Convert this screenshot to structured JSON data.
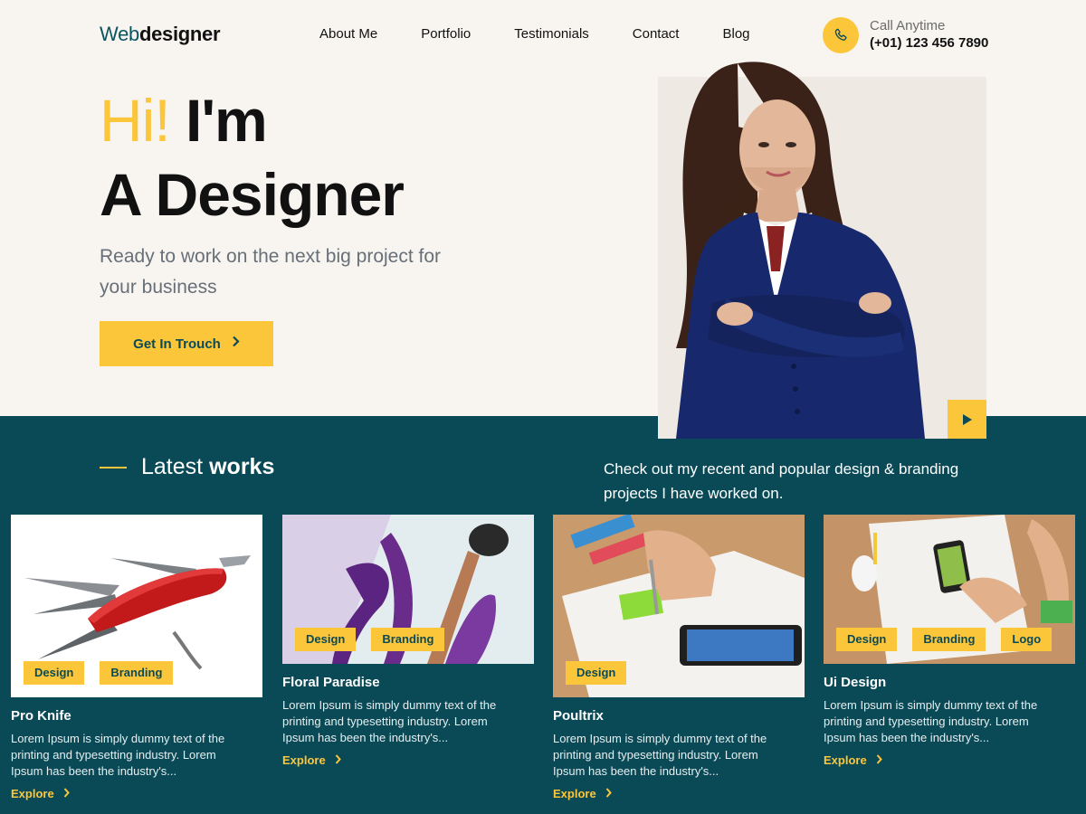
{
  "header": {
    "logo_part1": "Web",
    "logo_part2": "designer",
    "nav": [
      "About Me",
      "Portfolio",
      "Testimonials",
      "Contact",
      "Blog"
    ],
    "call_label": "Call Anytime",
    "call_number": "(+01) 123 456 7890",
    "call_icon": "phone-icon"
  },
  "hero": {
    "hi": "Hi!",
    "im": "I'm",
    "line2": "A Designer",
    "subtitle": "Ready to work on the next big project for your business",
    "cta_label": "Get In Trouch",
    "play_icon": "play-icon"
  },
  "works": {
    "title_light": "Latest",
    "title_bold": "works",
    "description": "Check out my recent and popular design & branding projects I have worked on.",
    "cards": [
      {
        "title": "Pro Knife",
        "tags": [
          "Design",
          "Branding"
        ],
        "text": "Lorem Ipsum is simply dummy text of the printing and typesetting industry. Lorem Ipsum has been the industry's...",
        "explore": "Explore"
      },
      {
        "title": "Floral Paradise",
        "tags": [
          "Design",
          "Branding"
        ],
        "text": "Lorem Ipsum is simply dummy text of the printing and typesetting industry. Lorem Ipsum has been the industry's...",
        "explore": "Explore"
      },
      {
        "title": "Poultrix",
        "tags": [
          "Design"
        ],
        "text": "Lorem Ipsum is simply dummy text of the printing and typesetting industry. Lorem Ipsum has been the industry's...",
        "explore": "Explore"
      },
      {
        "title": "Ui Design",
        "tags": [
          "Design",
          "Branding",
          "Logo"
        ],
        "text": "Lorem Ipsum is simply dummy text of the printing and typesetting industry. Lorem Ipsum has been the industry's...",
        "explore": "Explore"
      }
    ]
  },
  "colors": {
    "accent": "#fcc63a",
    "teal": "#0a4a56",
    "background": "#f8f5f1"
  }
}
